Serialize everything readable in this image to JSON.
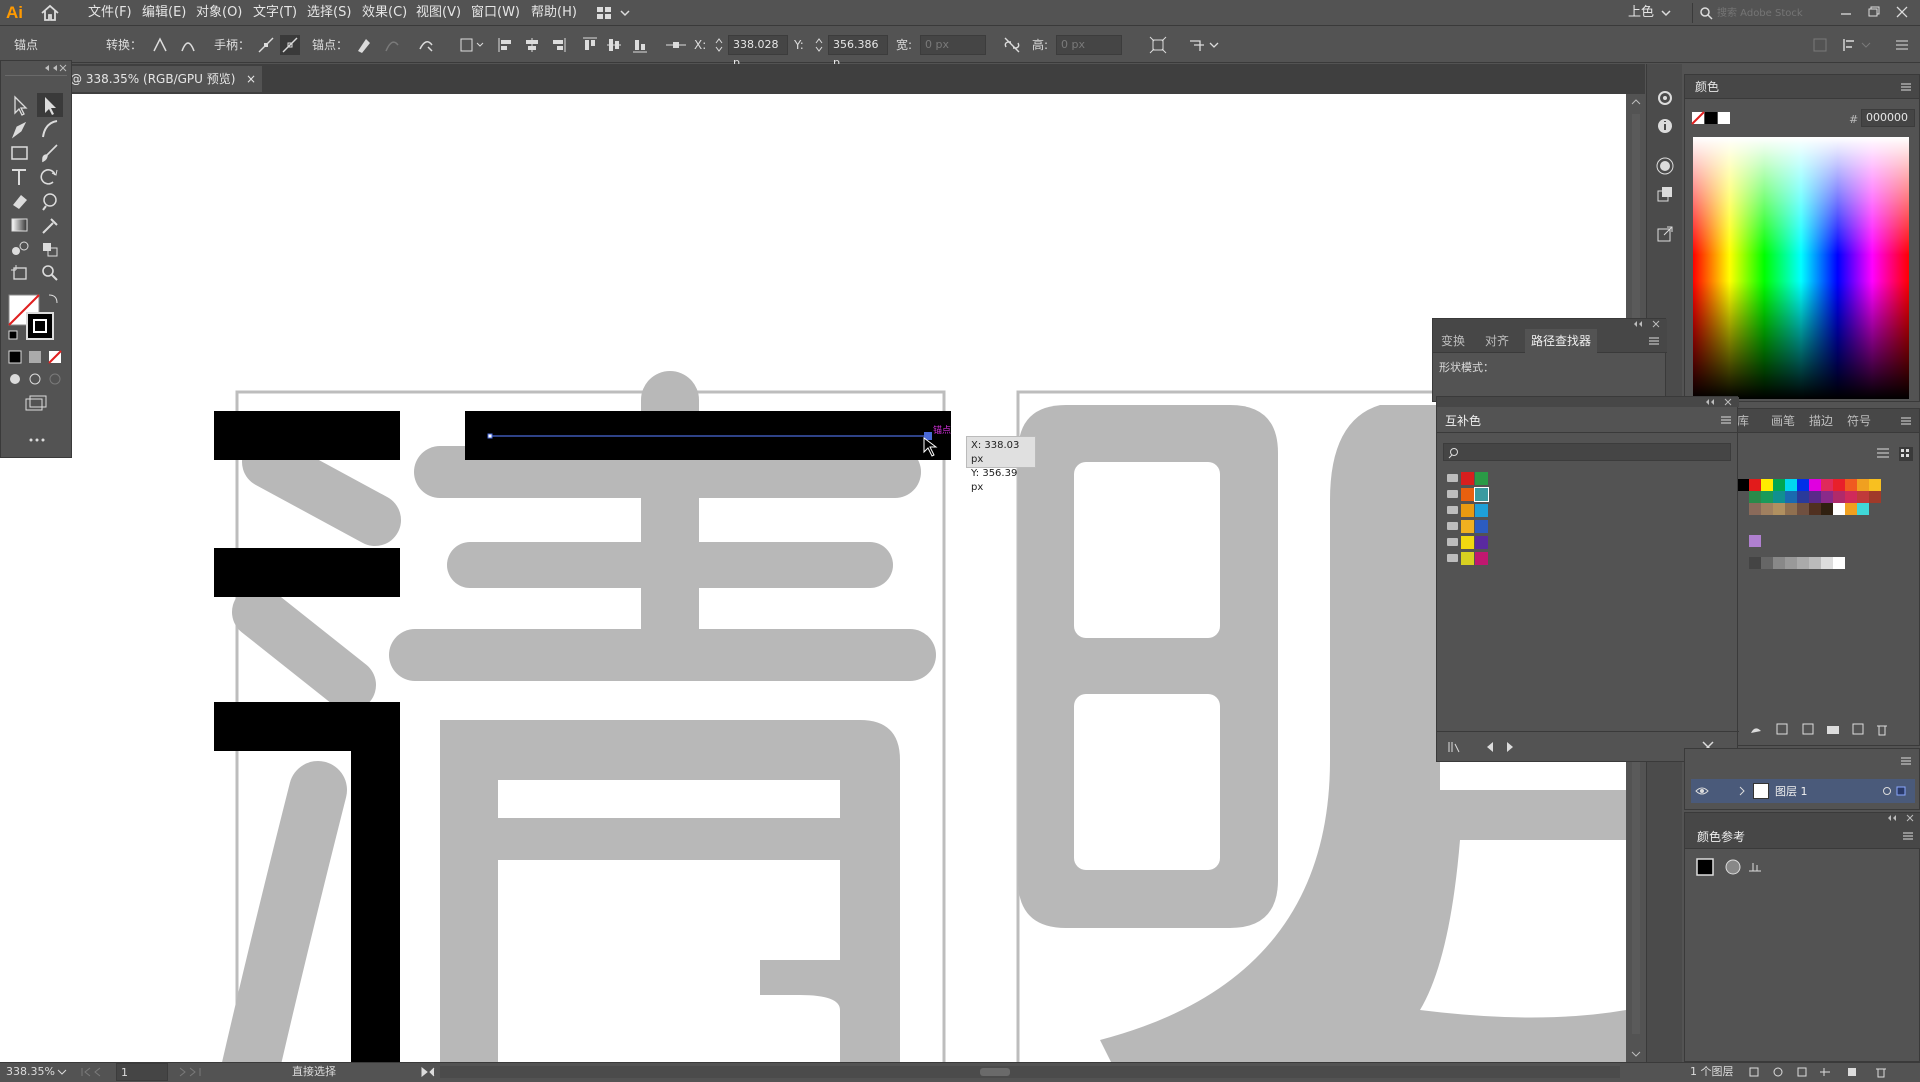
{
  "app": {
    "logo": "Ai",
    "menus": [
      "文件(F)",
      "编辑(E)",
      "对象(O)",
      "文字(T)",
      "选择(S)",
      "效果(C)",
      "视图(V)",
      "窗口(W)",
      "帮助(H)"
    ],
    "workspace": "上色",
    "search_placeholder": "搜索 Adobe Stock"
  },
  "control_bar": {
    "context_label": "锚点",
    "convert_label": "转换：",
    "handle_label": "手柄：",
    "anchor_label": "锚点：",
    "x_label": "X:",
    "x_value": "338.028 p",
    "y_label": "Y:",
    "y_value": "356.386 p",
    "w_label": "宽:",
    "w_value": "0 px",
    "h_label": "高:",
    "h_value": "0 px"
  },
  "document": {
    "tab_title": "@ 338.35% (RGB/GPU 预览)",
    "close": "×"
  },
  "canvas": {
    "tooltip_x": "X: 338.03 px",
    "tooltip_y": "Y: 356.39 px",
    "anchor_hint": "锚点",
    "colors": {
      "glyph": "#b8b8b8",
      "guide": "#bdbdbd",
      "fill": "#000000",
      "path": "#4a6ad8",
      "hint": "#d02fd8"
    }
  },
  "panels": {
    "color": {
      "title": "颜色",
      "hex_label": "#",
      "hex_value": "000000"
    },
    "transform_group": {
      "tabs": [
        "变换",
        "对齐",
        "路径查找器"
      ],
      "shape_modes": "形状模式："
    },
    "harmony": {
      "title": "互补色",
      "rows": [
        [
          "#d81e1e",
          "#2a9a46"
        ],
        [
          "#e8600f",
          "#3a9aa0"
        ],
        [
          "#e89a10",
          "#1ea0d8"
        ],
        [
          "#f0b020",
          "#2c5cc0"
        ],
        [
          "#f0d810",
          "#5a2aa0"
        ],
        [
          "#d8d020",
          "#c01870"
        ]
      ]
    },
    "swatches": {
      "tabs": [
        "库",
        "画笔",
        "描边",
        "符号"
      ]
    },
    "layers": {
      "layer_name": "图层 1",
      "count": "1 个图层"
    },
    "color_guide": {
      "title": "颜色参考"
    }
  },
  "status": {
    "zoom": "338.35%",
    "artboard": "1",
    "tool": "直接选择"
  }
}
